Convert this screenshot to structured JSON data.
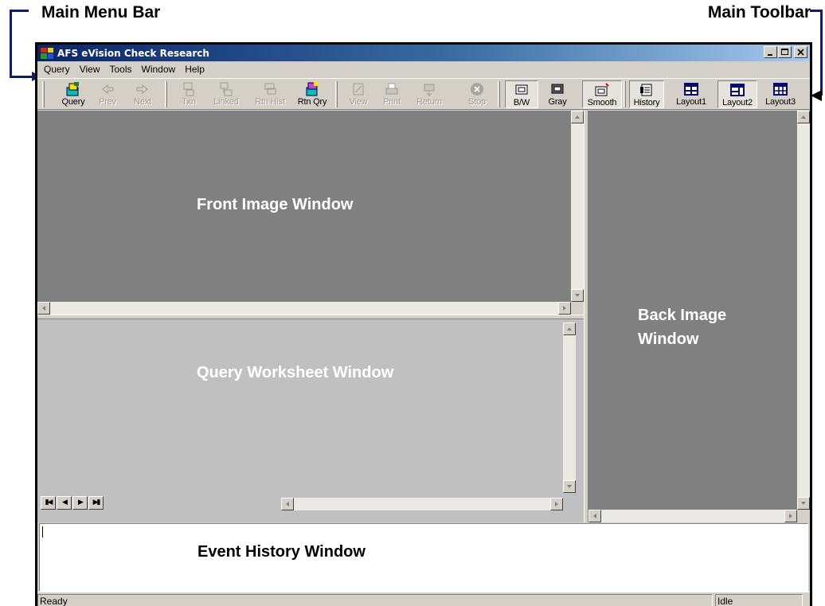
{
  "callouts": {
    "menu_bar": "Main Menu Bar",
    "toolbar": "Main Toolbar"
  },
  "window": {
    "title": "AFS eVision Check Research"
  },
  "menu": [
    "Query",
    "View",
    "Tools",
    "Window",
    "Help"
  ],
  "toolbar": [
    {
      "label": "Query",
      "icon": "query-icon",
      "enabled": true,
      "pressed": false
    },
    {
      "label": "Prev",
      "icon": "arrow-left-icon",
      "enabled": false,
      "pressed": false
    },
    {
      "label": "Next",
      "icon": "arrow-right-icon",
      "enabled": false,
      "pressed": false
    },
    {
      "label": "Txn",
      "icon": "transaction-icon",
      "enabled": false,
      "pressed": false
    },
    {
      "label": "Linked",
      "icon": "linked-icon",
      "enabled": false,
      "pressed": false
    },
    {
      "label": "Rtn Hist",
      "icon": "return-history-icon",
      "enabled": false,
      "pressed": false
    },
    {
      "label": "Rtn Qry",
      "icon": "return-query-icon",
      "enabled": true,
      "pressed": false
    },
    {
      "label": "View",
      "icon": "view-icon",
      "enabled": false,
      "pressed": false
    },
    {
      "label": "Print",
      "icon": "printer-icon",
      "enabled": false,
      "pressed": false
    },
    {
      "label": "Return",
      "icon": "return-icon",
      "enabled": false,
      "pressed": false
    },
    {
      "label": "Stop",
      "icon": "stop-icon",
      "enabled": false,
      "pressed": false
    },
    {
      "label": "B/W",
      "icon": "black-white-icon",
      "enabled": true,
      "pressed": true
    },
    {
      "label": "Gray",
      "icon": "grayscale-icon",
      "enabled": true,
      "pressed": false
    },
    {
      "label": "Smooth",
      "icon": "smooth-icon",
      "enabled": true,
      "pressed": true
    },
    {
      "label": "History",
      "icon": "history-icon",
      "enabled": true,
      "pressed": true
    },
    {
      "label": "Layout1",
      "icon": "layout1-icon",
      "enabled": true,
      "pressed": false
    },
    {
      "label": "Layout2",
      "icon": "layout2-icon",
      "enabled": true,
      "pressed": true
    },
    {
      "label": "Layout3",
      "icon": "layout3-icon",
      "enabled": true,
      "pressed": false
    }
  ],
  "panes": {
    "front_image": "Front Image Window",
    "back_image_line1": "Back Image",
    "back_image_line2": "Window",
    "query_worksheet": "Query Worksheet Window",
    "event_history": "Event History Window"
  },
  "status": {
    "left": "Ready",
    "right": "Idle"
  },
  "colors": {
    "image_pane": "#808080",
    "worksheet_pane": "#c0c0c0",
    "accent": "#0f1b6f"
  }
}
